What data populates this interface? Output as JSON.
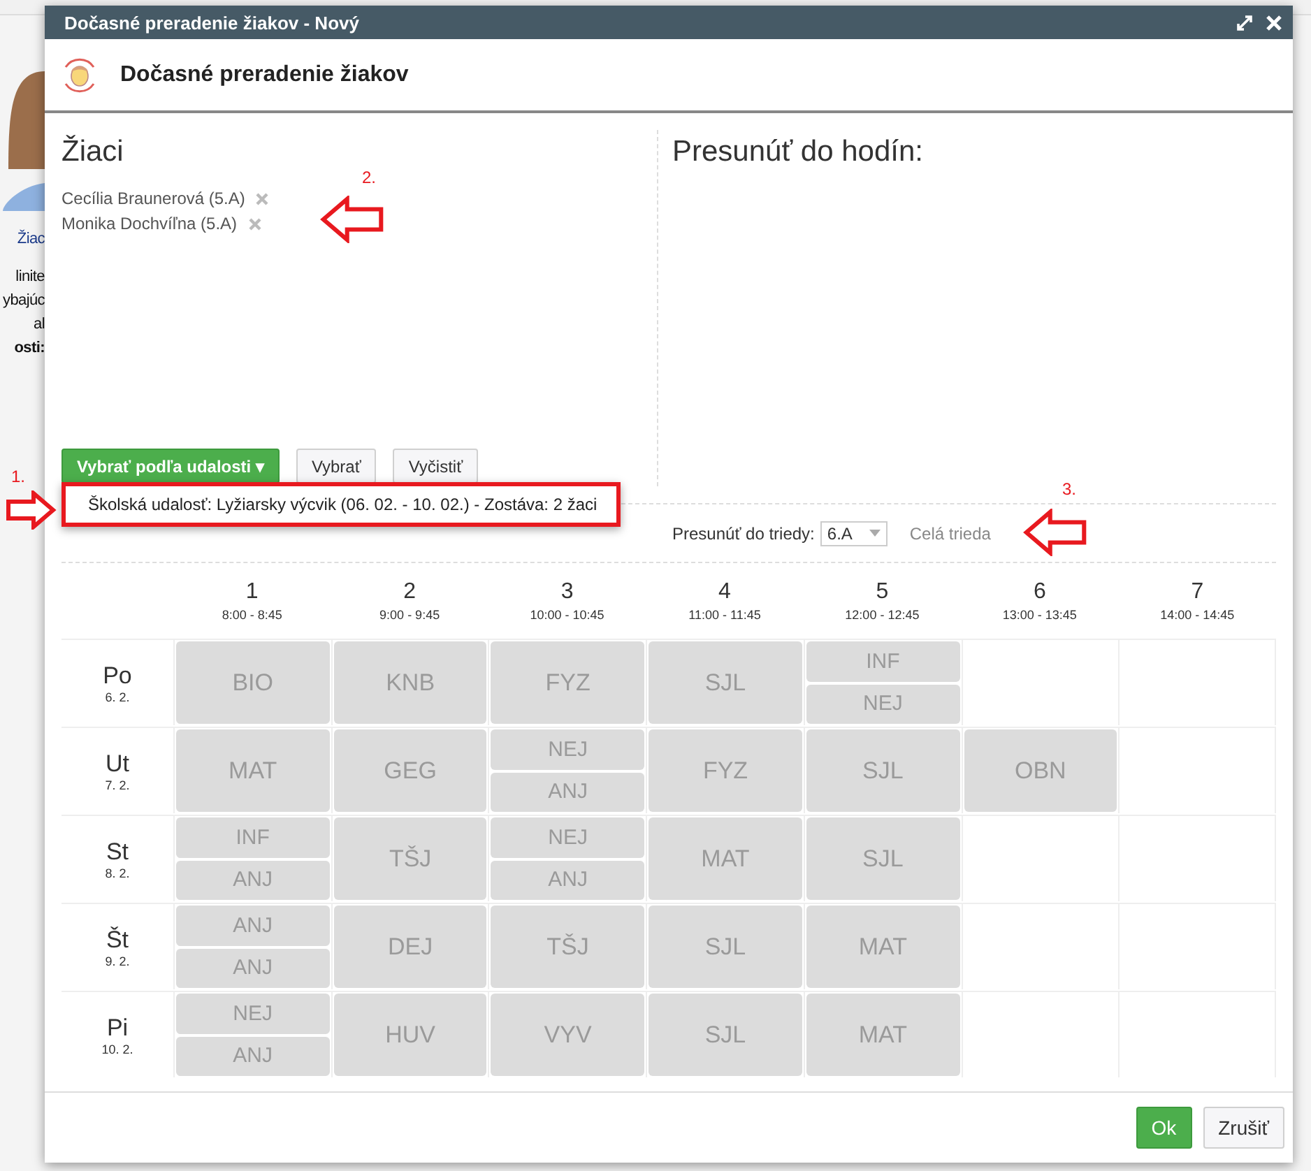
{
  "background_page": {
    "texts": [
      "Žiac",
      "linite",
      "ybajúc",
      "al",
      "osti:"
    ]
  },
  "window": {
    "title": "Dočasné preradenie žiakov - Nový"
  },
  "header": {
    "title": "Dočasné preradenie žiakov"
  },
  "students": {
    "heading": "Žiaci",
    "items": [
      {
        "name": "Cecília Braunerová (5.A)"
      },
      {
        "name": "Monika Dochvíľna (5.A)"
      }
    ],
    "buttons": [
      {
        "label": "Vybrať podľa udalosti ▾",
        "kind": "primary"
      },
      {
        "label": "Vybrať",
        "kind": "default"
      },
      {
        "label": "Vyčistiť",
        "kind": "default"
      }
    ]
  },
  "event_menu": {
    "items": [
      "Školská udalosť: Lyžiarsky výcvik (06. 02. - 10. 02.) - Zostáva: 2 žaci"
    ]
  },
  "target": {
    "heading": "Presunúť do hodín:",
    "class_label": "Presunúť do triedy:",
    "class_value": "6.A",
    "whole_class": "Celá trieda"
  },
  "timetable": {
    "periods": [
      {
        "number": "1",
        "time": "8:00 - 8:45"
      },
      {
        "number": "2",
        "time": "9:00 - 9:45"
      },
      {
        "number": "3",
        "time": "10:00 - 10:45"
      },
      {
        "number": "4",
        "time": "11:00 - 11:45"
      },
      {
        "number": "5",
        "time": "12:00 - 12:45"
      },
      {
        "number": "6",
        "time": "13:00 - 13:45"
      },
      {
        "number": "7",
        "time": "14:00 - 14:45"
      }
    ],
    "rows": [
      {
        "day": "Po",
        "date": "6. 2.",
        "cells": [
          {
            "kind": "lesson",
            "subjects": [
              "BIO"
            ]
          },
          {
            "kind": "lesson",
            "subjects": [
              "KNB"
            ]
          },
          {
            "kind": "lesson",
            "subjects": [
              "FYZ"
            ]
          },
          {
            "kind": "lesson",
            "subjects": [
              "SJL"
            ]
          },
          {
            "kind": "lesson",
            "subjects": [
              "INF",
              "NEJ"
            ]
          },
          {
            "kind": "free"
          },
          {
            "kind": "free"
          }
        ]
      },
      {
        "day": "Ut",
        "date": "7. 2.",
        "cells": [
          {
            "kind": "lesson",
            "subjects": [
              "MAT"
            ]
          },
          {
            "kind": "lesson",
            "subjects": [
              "GEG"
            ]
          },
          {
            "kind": "lesson",
            "subjects": [
              "NEJ",
              "ANJ"
            ]
          },
          {
            "kind": "lesson",
            "subjects": [
              "FYZ"
            ]
          },
          {
            "kind": "lesson",
            "subjects": [
              "SJL"
            ]
          },
          {
            "kind": "lesson",
            "subjects": [
              "OBN"
            ]
          },
          {
            "kind": "free"
          }
        ]
      },
      {
        "day": "St",
        "date": "8. 2.",
        "cells": [
          {
            "kind": "lesson",
            "subjects": [
              "INF",
              "ANJ"
            ]
          },
          {
            "kind": "lesson",
            "subjects": [
              "TŠJ"
            ]
          },
          {
            "kind": "lesson",
            "subjects": [
              "NEJ",
              "ANJ"
            ]
          },
          {
            "kind": "lesson",
            "subjects": [
              "MAT"
            ]
          },
          {
            "kind": "lesson",
            "subjects": [
              "SJL"
            ]
          },
          {
            "kind": "free"
          },
          {
            "kind": "free"
          }
        ]
      },
      {
        "day": "Št",
        "date": "9. 2.",
        "cells": [
          {
            "kind": "lesson",
            "subjects": [
              "ANJ",
              "ANJ"
            ]
          },
          {
            "kind": "lesson",
            "subjects": [
              "DEJ"
            ]
          },
          {
            "kind": "lesson",
            "subjects": [
              "TŠJ"
            ]
          },
          {
            "kind": "lesson",
            "subjects": [
              "SJL"
            ]
          },
          {
            "kind": "lesson",
            "subjects": [
              "MAT"
            ]
          },
          {
            "kind": "free"
          },
          {
            "kind": "free"
          }
        ]
      },
      {
        "day": "Pi",
        "date": "10. 2.",
        "cells": [
          {
            "kind": "lesson",
            "subjects": [
              "NEJ",
              "ANJ"
            ]
          },
          {
            "kind": "lesson",
            "subjects": [
              "HUV"
            ]
          },
          {
            "kind": "lesson",
            "subjects": [
              "VYV"
            ]
          },
          {
            "kind": "lesson",
            "subjects": [
              "SJL"
            ]
          },
          {
            "kind": "lesson",
            "subjects": [
              "MAT"
            ]
          },
          {
            "kind": "free"
          },
          {
            "kind": "free"
          }
        ]
      }
    ]
  },
  "footer": {
    "buttons": [
      {
        "label": "Ok",
        "kind": "primary"
      },
      {
        "label": "Zrušiť",
        "kind": "default"
      }
    ]
  },
  "annotations": [
    "1.",
    "2.",
    "3."
  ]
}
